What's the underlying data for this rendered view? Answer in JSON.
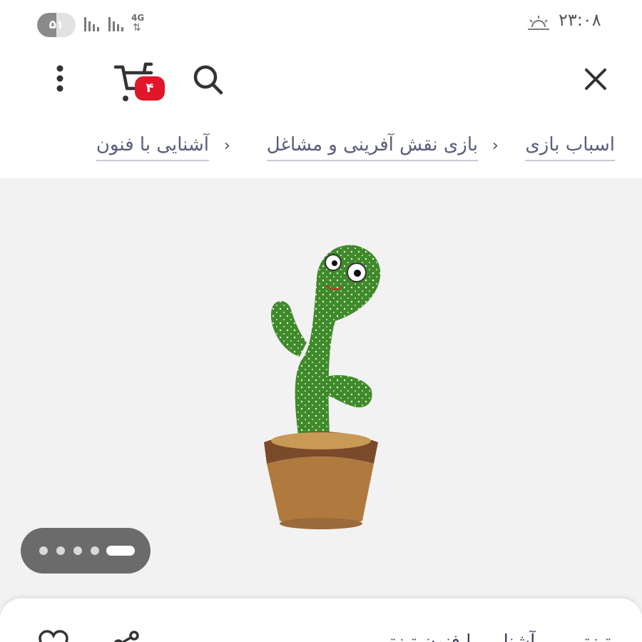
{
  "status_bar": {
    "battery_level": "۵۱",
    "battery_fraction": 0.5,
    "network": "4G",
    "network_arrows": "⇅",
    "time": "۲۳:۰۸",
    "icons": [
      "battery-icon",
      "signal-icon",
      "signal-icon",
      "sunrise-icon"
    ]
  },
  "toolbar": {
    "cart_count": "۴",
    "icons": [
      "more-vertical-icon",
      "cart-icon",
      "search-icon",
      "close-icon"
    ],
    "badge_color": "#e0162b"
  },
  "breadcrumb": {
    "items": [
      "اسباب بازی",
      "بازی نقش آفرینی و مشاغل",
      "آشنایی با فنون"
    ],
    "separator": "›"
  },
  "gallery": {
    "image": "dancing-cactus-toy",
    "pages": 5,
    "active_page": 5
  },
  "sheet": {
    "title_partial": "تیزتیں ... آشنایی با فنون تیزتیں",
    "icons": [
      "heart-icon",
      "share-icon"
    ]
  }
}
